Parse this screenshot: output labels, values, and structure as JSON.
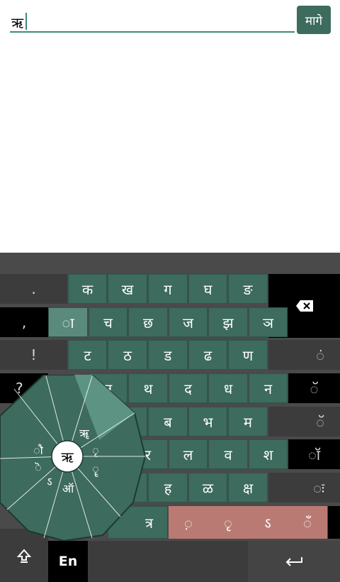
{
  "input": {
    "value": "ऋ",
    "button_label": "मागे"
  },
  "keyboard": {
    "left_col": [
      ".",
      ",",
      "!",
      "?"
    ],
    "row1": [
      "क",
      "ख",
      "ग",
      "घ",
      "ङ"
    ],
    "row2": [
      "ा",
      "च",
      "छ",
      "ज",
      "झ",
      "ञ"
    ],
    "row3": [
      "ट",
      "ठ",
      "ड",
      "ढ",
      "ण"
    ],
    "row4": [
      "थ",
      "द",
      "ध",
      "न"
    ],
    "row5": [
      "ब",
      "भ",
      "म"
    ],
    "row6": [
      "ल",
      "व",
      "श"
    ],
    "row7": [
      "ह",
      "ळ",
      "क्ष"
    ],
    "row8": [
      "त्र",
      "़",
      "ृ",
      "ऽ",
      "ँ"
    ],
    "right_col": [
      "ं",
      "ॅ",
      "ॅ",
      "ॉ",
      "ः"
    ],
    "wheel": {
      "center": "ऋ",
      "labels": [
        "ॠ",
        "ृ",
        "ॄ",
        "ऑ",
        "ऽ",
        "ॆ",
        "ौ"
      ]
    },
    "lang_label": "En",
    "shift_icon": "shift-arrow-icon",
    "backspace_icon": "backspace-icon",
    "enter_icon": "enter-arrow-icon"
  },
  "colors": {
    "accent": "#3d6b5e",
    "special_keys": "#b97a73",
    "keyboard_bg": "#4a4a4a"
  }
}
